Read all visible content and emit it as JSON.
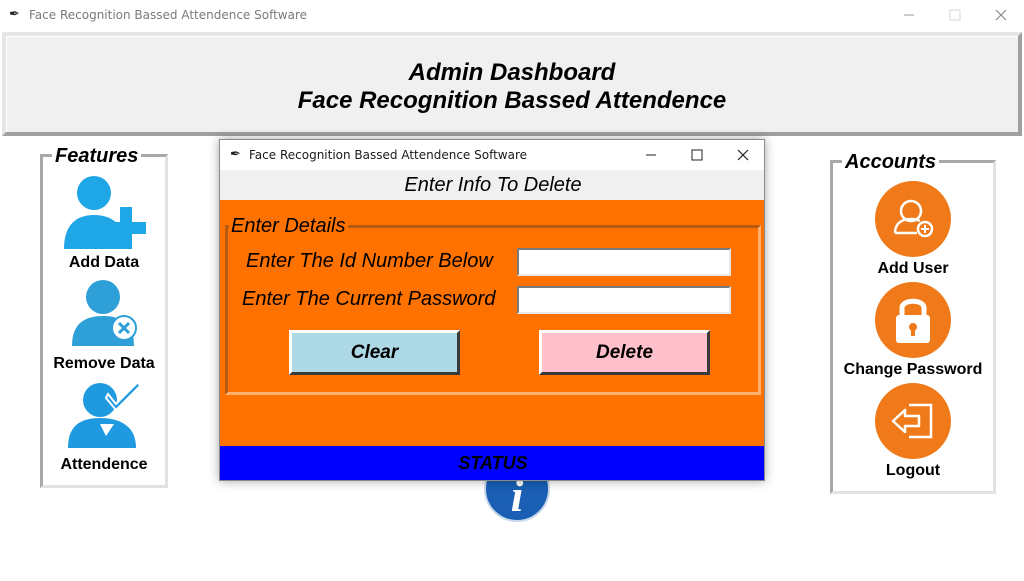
{
  "window": {
    "title": "Face Recognition Bassed Attendence Software",
    "minimize": "—",
    "maximize": "☐",
    "close": "✕"
  },
  "header": {
    "line1": "Admin Dashboard",
    "line2": "Face Recognition Bassed Attendence"
  },
  "features": {
    "title": "Features",
    "items": [
      {
        "label": "Add Data",
        "icon": "add-user-icon"
      },
      {
        "label": "Remove Data",
        "icon": "remove-user-icon"
      },
      {
        "label": "Attendence",
        "icon": "user-check-icon"
      }
    ]
  },
  "accounts": {
    "title": "Accounts",
    "items": [
      {
        "label": "Add User",
        "icon": "add-user-circle-icon"
      },
      {
        "label": "Change Password",
        "icon": "lock-icon"
      },
      {
        "label": "Logout",
        "icon": "logout-icon"
      }
    ]
  },
  "dialog": {
    "title": "Face Recognition Bassed Attendence Software",
    "heading": "Enter Info To Delete",
    "group_title": "Enter Details",
    "id_label": "Enter The Id Number Below",
    "id_value": "",
    "password_label": "Enter The Current Password",
    "password_value": "",
    "clear_label": "Clear",
    "delete_label": "Delete",
    "status": "STATUS",
    "colors": {
      "body": "#ff7200",
      "status_bar": "#0000ff",
      "clear_button": "#add8e6",
      "delete_button": "#ffc0cb"
    }
  }
}
